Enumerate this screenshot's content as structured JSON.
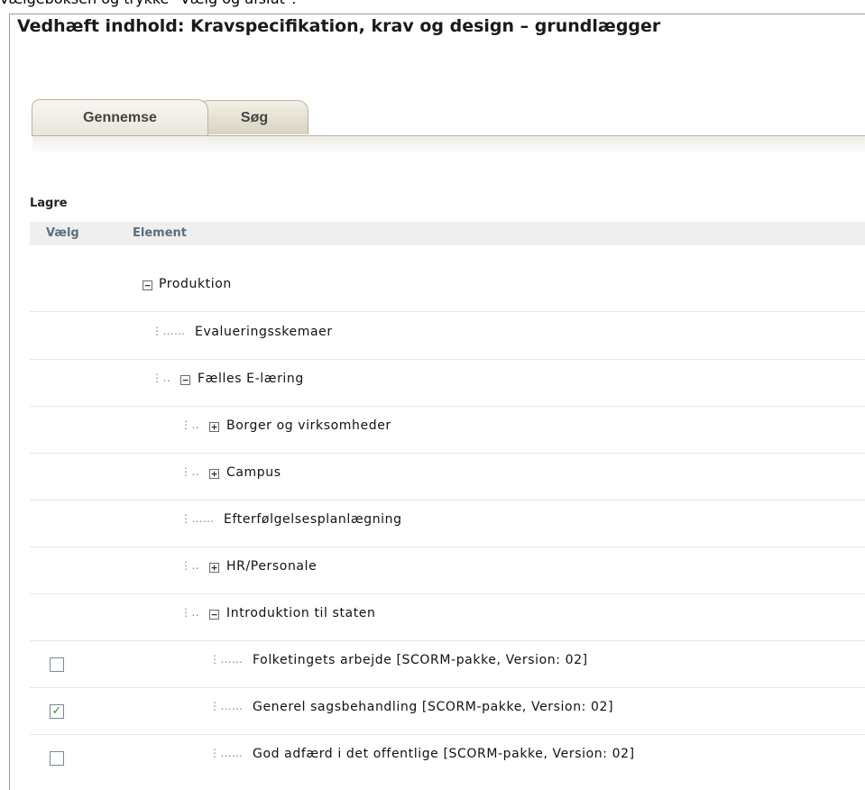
{
  "top_text": "vælgeboksen og trykke \"Vælg og afslut\".",
  "panel_title": "Vedhæft indhold: Kravspecifikation, krav og design – grundlægger",
  "tabs": {
    "browse": "Gennemse",
    "search": "Søg"
  },
  "section_title": "Lagre",
  "table": {
    "col_select": "Vælg",
    "col_element": "Element"
  },
  "tree": [
    {
      "label": "Produktion",
      "toggle": "−"
    },
    {
      "label": "Evalueringsskemaer",
      "dots": "⋮……"
    },
    {
      "label": "Fælles E-læring",
      "toggle": "−",
      "dots": "⋮.."
    },
    {
      "label": "Borger og virksomheder",
      "toggle": "+",
      "dots": "⋮.."
    },
    {
      "label": "Campus",
      "toggle": "+",
      "dots": "⋮.."
    },
    {
      "label": "Efterfølgelsesplanlægning",
      "dots": "⋮……"
    },
    {
      "label": "HR/Personale",
      "toggle": "+",
      "dots": "⋮.."
    },
    {
      "label": "Introduktion til staten",
      "toggle": "−",
      "dots": "⋮.."
    },
    {
      "label": "Folketingets arbejde [SCORM-pakke, Version: 02]",
      "dots": "⋮……",
      "checked": false,
      "checkmark": ""
    },
    {
      "label": "Generel sagsbehandling [SCORM-pakke, Version: 02]",
      "dots": "⋮……",
      "checked": true,
      "checkmark": "✓"
    },
    {
      "label": "God adfærd i det offentlige [SCORM-pakke, Version: 02]",
      "dots": "⋮……",
      "checked": false,
      "checkmark": ""
    }
  ]
}
